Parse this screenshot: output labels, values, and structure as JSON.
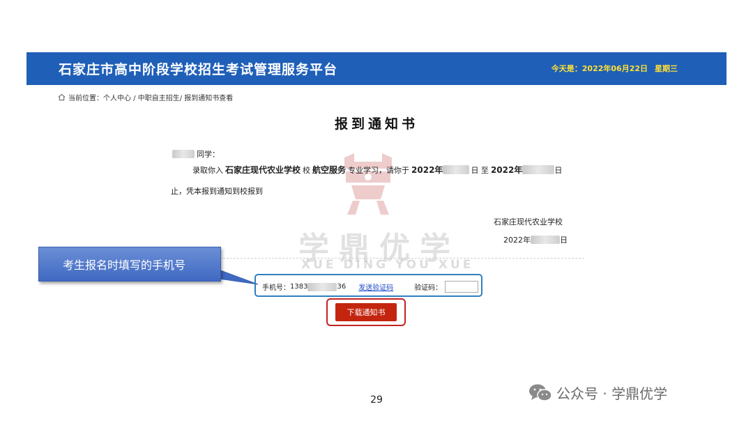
{
  "header": {
    "title": "石家庄市高中阶段学校招生考试管理服务平台",
    "today_label": "今天是：2022年06月22日",
    "weekday": "星期三"
  },
  "breadcrumb": {
    "text": "当前位置：个人中心 / 中职自主招生/ 报到通知书查看"
  },
  "notice": {
    "title": "报到通知书",
    "student_suffix": "同学：",
    "admit_prefix": "录取你入",
    "school": "石家庄现代农业学校",
    "school_suffix": "校",
    "major": "航空服务",
    "major_suffix": "专业学习，请你于",
    "year_start": "2022年",
    "day_start": "日 至",
    "year_end": "2022年",
    "day_end": "日",
    "line2": "止，凭本报到通知到校报到",
    "sign_school": "石家庄现代农业学校",
    "sign_year": "2022年",
    "sign_day": "日"
  },
  "watermark": {
    "cn": "学鼎优学",
    "en": "XUE DING YOU XUE"
  },
  "callout": {
    "text": "考生报名时填写的手机号"
  },
  "verify": {
    "phone_label": "手机号：",
    "phone_prefix": "1383",
    "phone_suffix": "36",
    "send_code": "发送验证码",
    "code_label": "验证码：",
    "code_value": ""
  },
  "download_button": "下载通知书",
  "page_number": "29",
  "brand": {
    "text": "公众号 · 学鼎优学"
  },
  "colors": {
    "header_bg": "#1f5fb8",
    "header_date": "#ffe033",
    "button_red": "#c4250f",
    "callout_blue": "#4a74c8",
    "highlight_blue": "#2e7fc1"
  }
}
